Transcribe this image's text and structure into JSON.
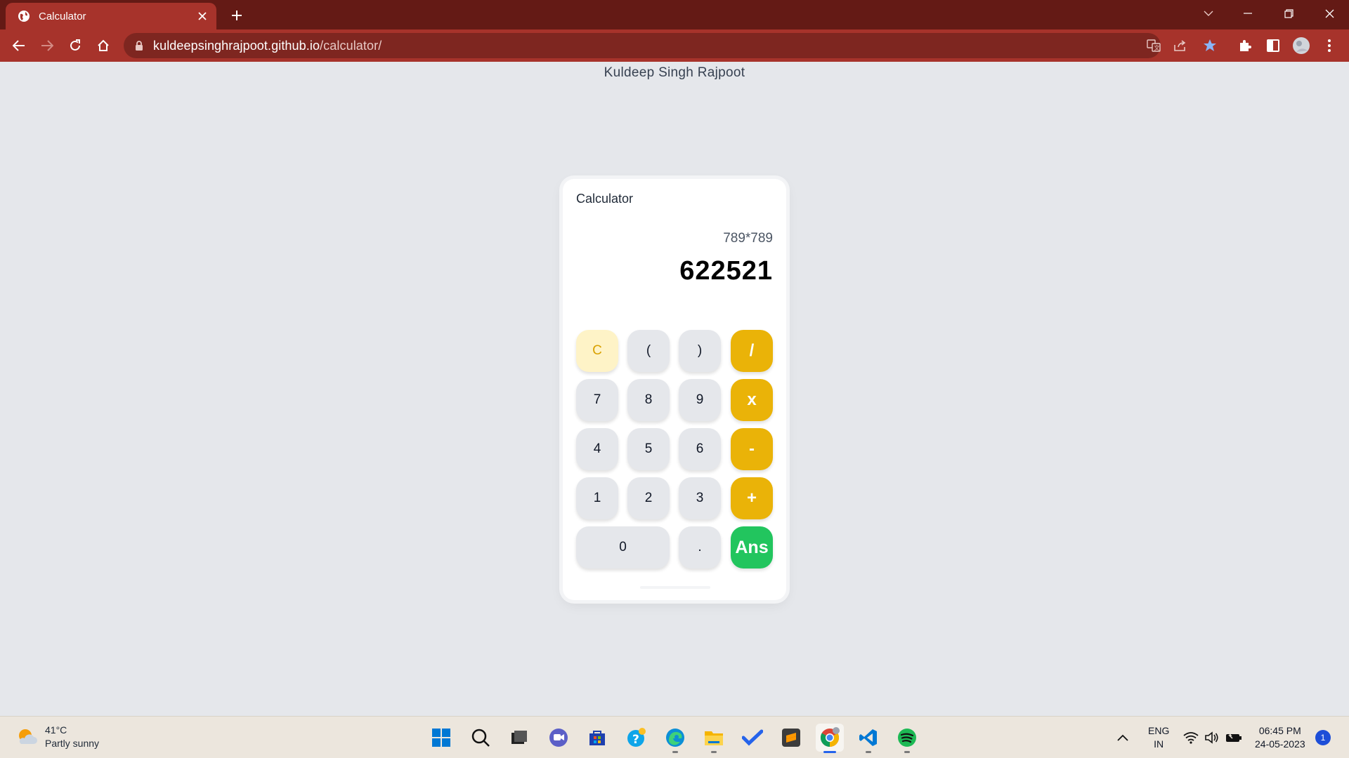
{
  "browser": {
    "tab_title": "Calculator",
    "url_host": "kuldeepsinghrajpoot.github.io",
    "url_path": "/calculator/"
  },
  "page": {
    "author": "Kuldeep Singh Rajpoot"
  },
  "calculator": {
    "title": "Calculator",
    "expression": "789*789",
    "result": "622521",
    "keys": {
      "clear": "C",
      "open_paren": "(",
      "close_paren": ")",
      "divide": "/",
      "seven": "7",
      "eight": "8",
      "nine": "9",
      "multiply": "x",
      "four": "4",
      "five": "5",
      "six": "6",
      "minus": "-",
      "one": "1",
      "two": "2",
      "three": "3",
      "plus": "+",
      "zero": "0",
      "dot": ".",
      "answer": "Ans"
    },
    "colors": {
      "operator": "#eab308",
      "answer": "#22c55e",
      "clear_bg": "#fef3c7",
      "digit_bg": "#e5e7eb"
    }
  },
  "taskbar": {
    "weather_temp": "41°C",
    "weather_desc": "Partly sunny",
    "lang_line1": "ENG",
    "lang_line2": "IN",
    "time": "06:45 PM",
    "date": "24-05-2023",
    "notifications": "1",
    "apps": [
      "start-icon",
      "search-icon",
      "task-view-icon",
      "chat-icon",
      "store-icon",
      "help-icon",
      "edge-icon",
      "file-explorer-icon",
      "todo-icon",
      "sublime-icon",
      "chrome-icon",
      "vscode-icon",
      "spotify-icon"
    ]
  },
  "theme": {
    "titlebar": "#641a15",
    "toolbar": "#a7332b",
    "page_bg": "#e5e7eb"
  }
}
